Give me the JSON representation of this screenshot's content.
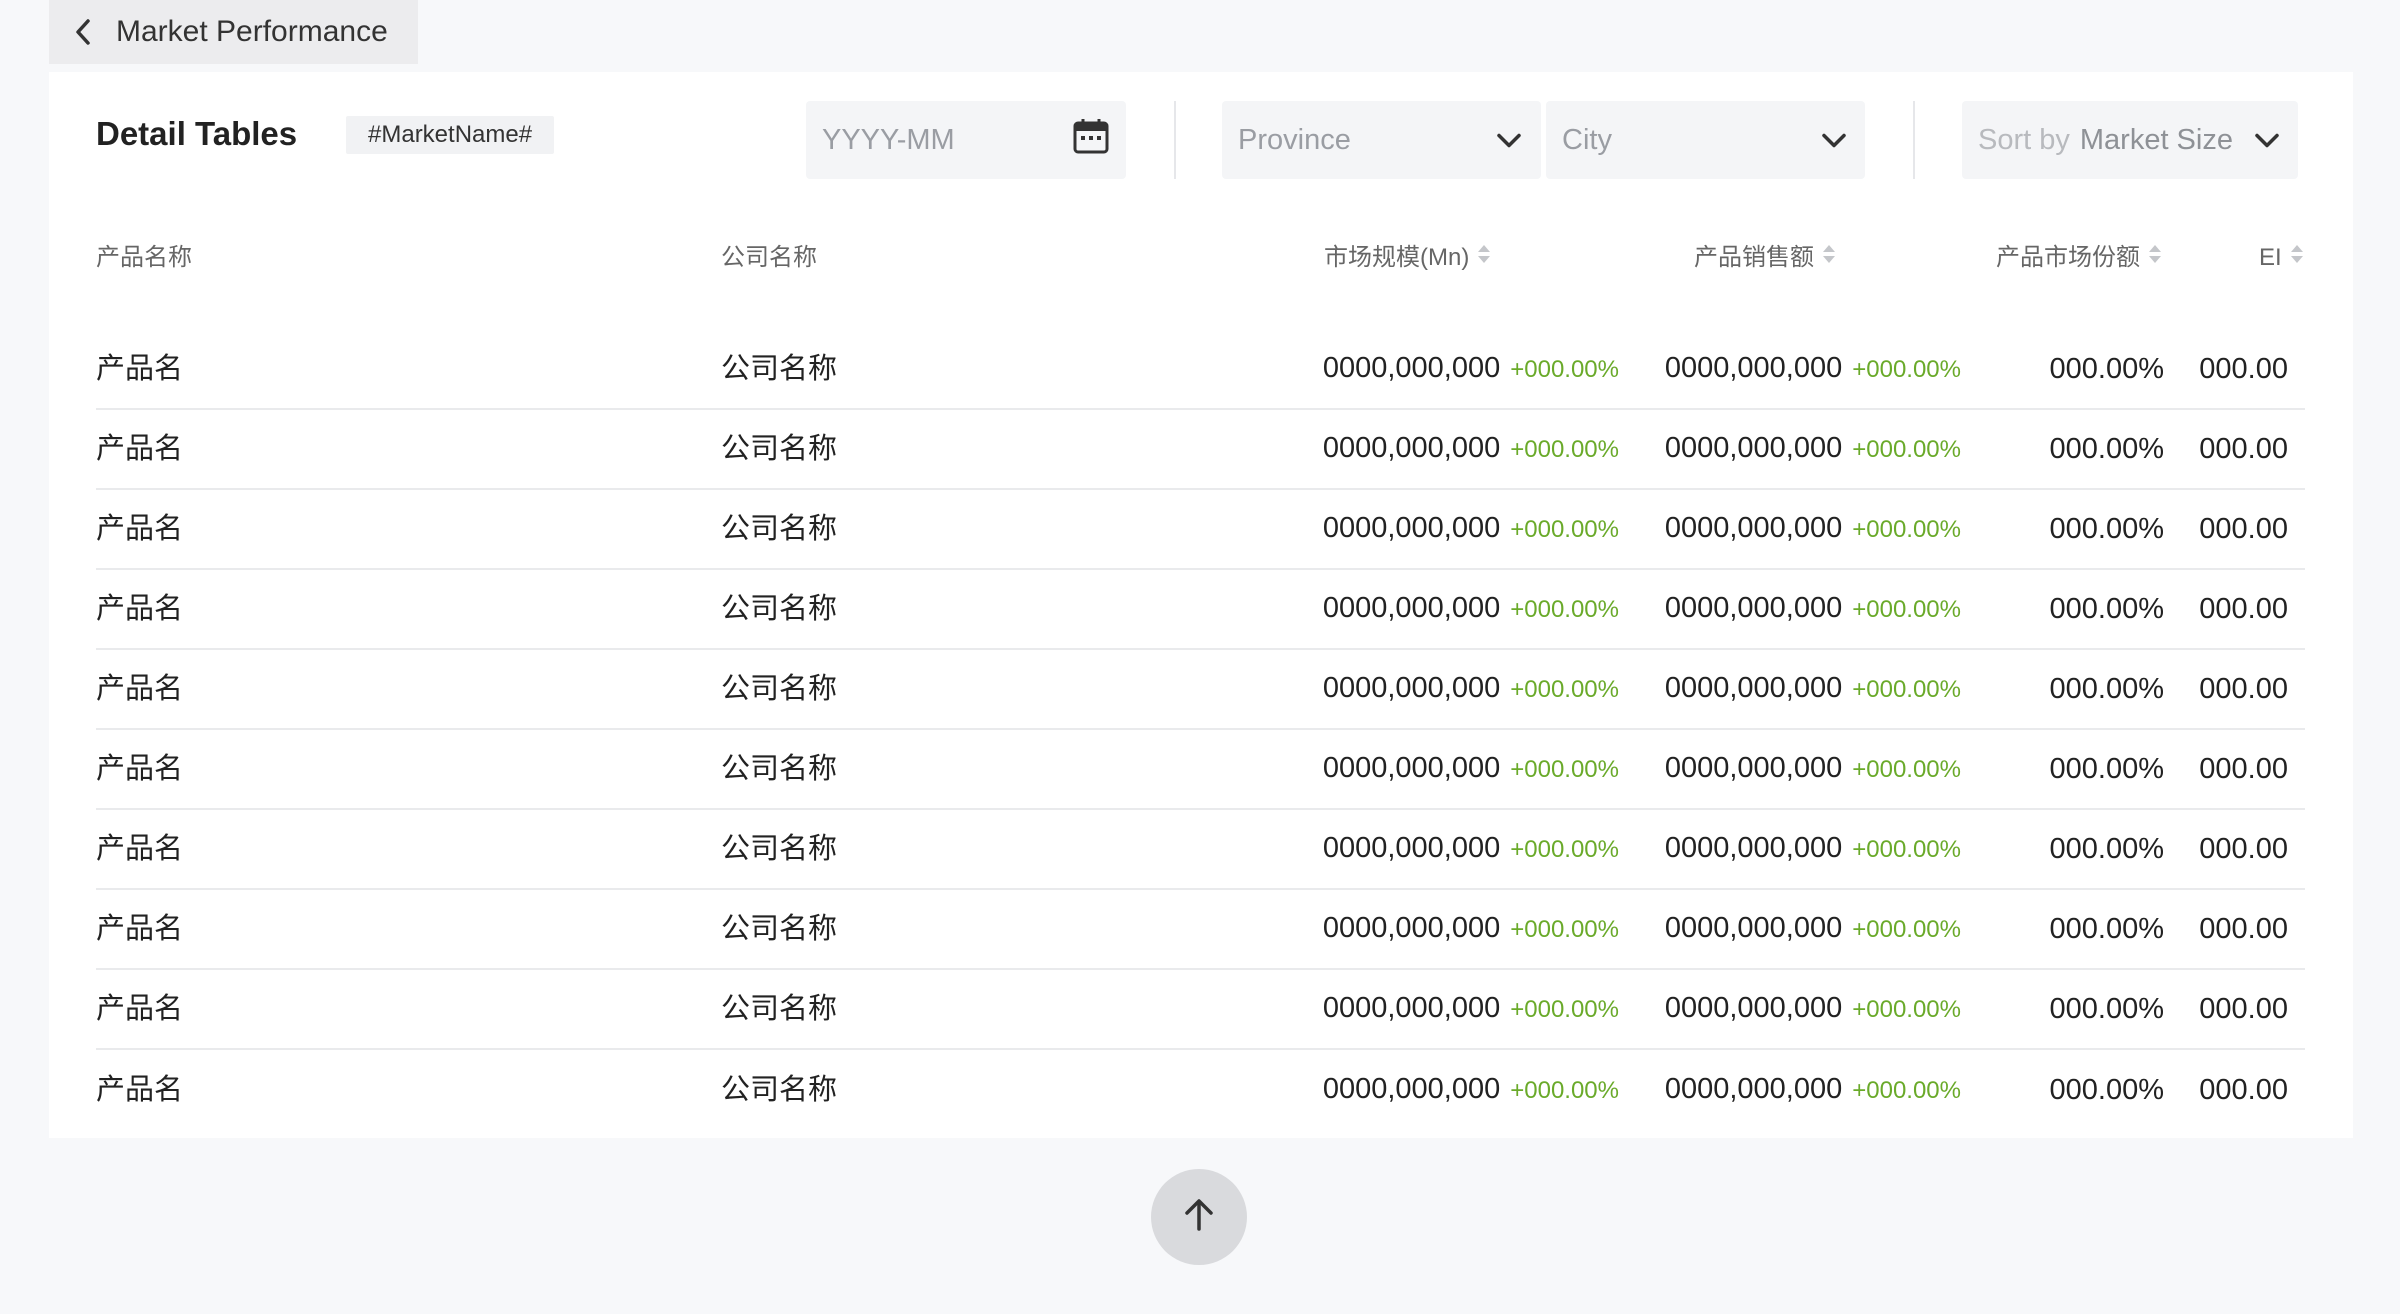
{
  "header": {
    "back_label": "Market Performance"
  },
  "section": {
    "title": "Detail Tables",
    "tag": "#MarketName#"
  },
  "filters": {
    "date_placeholder": "YYYY-MM",
    "province_placeholder": "Province",
    "city_placeholder": "City",
    "sort_prefix": "Sort by",
    "sort_value": "Market Size"
  },
  "table": {
    "columns": [
      "产品名称",
      "公司名称",
      "市场规模(Mn)",
      "产品销售额",
      "产品市场份额",
      "EI"
    ],
    "rows": [
      {
        "product": "产品名",
        "company": "公司名称",
        "market_size": "0000,000,000",
        "market_size_growth": "+000.00%",
        "sales": "0000,000,000",
        "sales_growth": "+000.00%",
        "share": "000.00%",
        "ei": "000.00"
      },
      {
        "product": "产品名",
        "company": "公司名称",
        "market_size": "0000,000,000",
        "market_size_growth": "+000.00%",
        "sales": "0000,000,000",
        "sales_growth": "+000.00%",
        "share": "000.00%",
        "ei": "000.00"
      },
      {
        "product": "产品名",
        "company": "公司名称",
        "market_size": "0000,000,000",
        "market_size_growth": "+000.00%",
        "sales": "0000,000,000",
        "sales_growth": "+000.00%",
        "share": "000.00%",
        "ei": "000.00"
      },
      {
        "product": "产品名",
        "company": "公司名称",
        "market_size": "0000,000,000",
        "market_size_growth": "+000.00%",
        "sales": "0000,000,000",
        "sales_growth": "+000.00%",
        "share": "000.00%",
        "ei": "000.00"
      },
      {
        "product": "产品名",
        "company": "公司名称",
        "market_size": "0000,000,000",
        "market_size_growth": "+000.00%",
        "sales": "0000,000,000",
        "sales_growth": "+000.00%",
        "share": "000.00%",
        "ei": "000.00"
      },
      {
        "product": "产品名",
        "company": "公司名称",
        "market_size": "0000,000,000",
        "market_size_growth": "+000.00%",
        "sales": "0000,000,000",
        "sales_growth": "+000.00%",
        "share": "000.00%",
        "ei": "000.00"
      },
      {
        "product": "产品名",
        "company": "公司名称",
        "market_size": "0000,000,000",
        "market_size_growth": "+000.00%",
        "sales": "0000,000,000",
        "sales_growth": "+000.00%",
        "share": "000.00%",
        "ei": "000.00"
      },
      {
        "product": "产品名",
        "company": "公司名称",
        "market_size": "0000,000,000",
        "market_size_growth": "+000.00%",
        "sales": "0000,000,000",
        "sales_growth": "+000.00%",
        "share": "000.00%",
        "ei": "000.00"
      },
      {
        "product": "产品名",
        "company": "公司名称",
        "market_size": "0000,000,000",
        "market_size_growth": "+000.00%",
        "sales": "0000,000,000",
        "sales_growth": "+000.00%",
        "share": "000.00%",
        "ei": "000.00"
      },
      {
        "product": "产品名",
        "company": "公司名称",
        "market_size": "0000,000,000",
        "market_size_growth": "+000.00%",
        "sales": "0000,000,000",
        "sales_growth": "+000.00%",
        "share": "000.00%",
        "ei": "000.00"
      }
    ]
  },
  "colors": {
    "accent_growth": "#6aaa2a",
    "page_background": "#f7f8fa",
    "card_background": "#ffffff",
    "control_background": "#f4f5f7"
  },
  "icons": {
    "back": "chevron-left-icon",
    "date": "calendar-icon",
    "dropdown": "chevron-down-icon",
    "sort": "sort-icon",
    "scroll_top": "arrow-up-icon"
  }
}
